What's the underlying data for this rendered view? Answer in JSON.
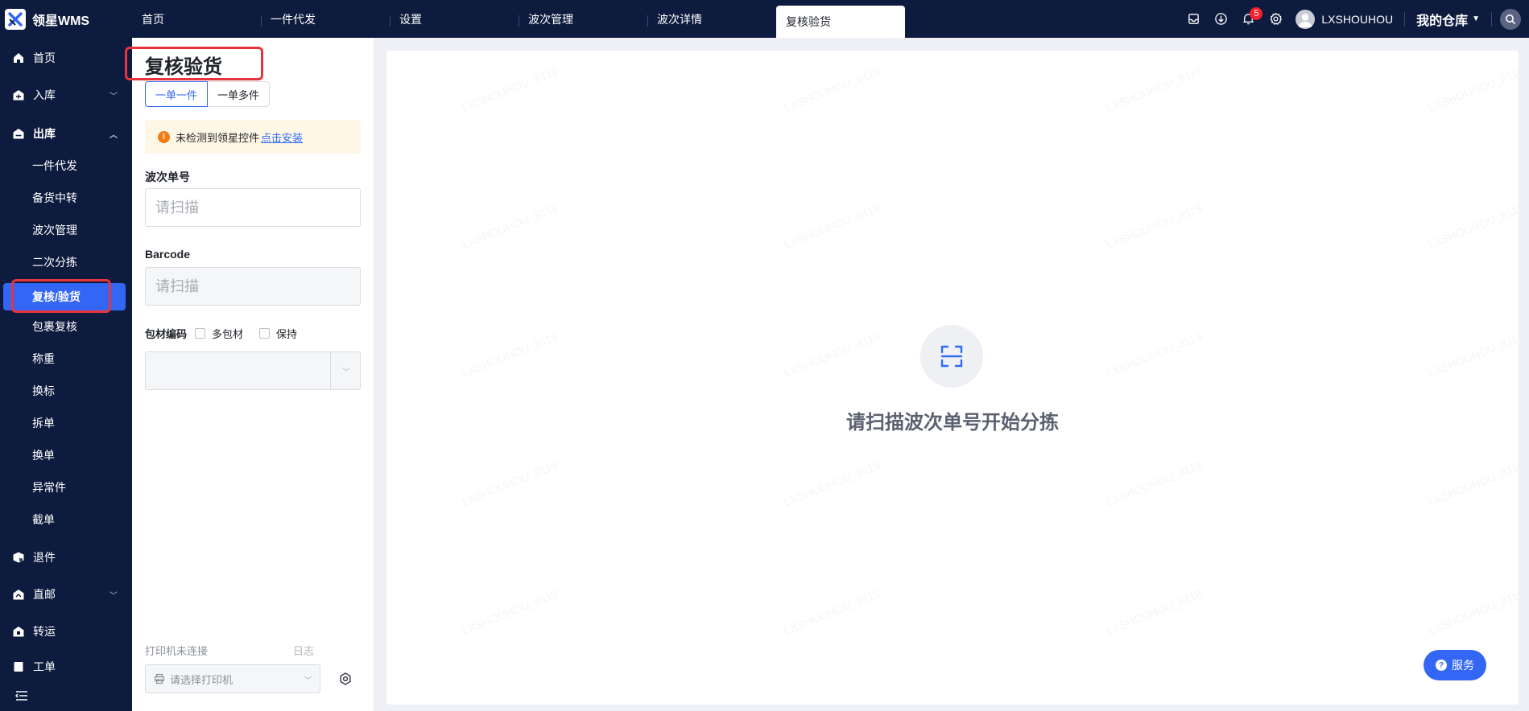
{
  "app": {
    "title": "领星WMS"
  },
  "tabs": [
    {
      "label": "首页"
    },
    {
      "label": "一件代发"
    },
    {
      "label": "设置"
    },
    {
      "label": "波次管理"
    },
    {
      "label": "波次详情"
    },
    {
      "label": "复核验货",
      "active": true
    }
  ],
  "topbar": {
    "notification_count": "5",
    "user_name": "LXSHOUHOU",
    "warehouse": "我的仓库",
    "icons": [
      "inbox-icon",
      "download-icon",
      "bell-icon",
      "settings-icon",
      "search-icon"
    ]
  },
  "sidebar": {
    "groups": [
      {
        "label": "首页",
        "icon": "home-icon"
      },
      {
        "label": "入库",
        "icon": "inbound-icon",
        "expandable": true
      },
      {
        "label": "出库",
        "icon": "outbound-icon",
        "expanded": true
      },
      {
        "label": "退件",
        "icon": "return-icon"
      },
      {
        "label": "直邮",
        "icon": "direct-mail-icon",
        "expandable": true
      },
      {
        "label": "转运",
        "icon": "transfer-icon"
      },
      {
        "label": "工单",
        "icon": "workorder-icon"
      }
    ],
    "items": [
      {
        "label": "一件代发"
      },
      {
        "label": "备货中转"
      },
      {
        "label": "波次管理"
      },
      {
        "label": "二次分拣"
      },
      {
        "label": "复核/验货",
        "active": true
      },
      {
        "label": "包裹复核"
      },
      {
        "label": "称重"
      },
      {
        "label": "换标"
      },
      {
        "label": "拆单"
      },
      {
        "label": "换单"
      },
      {
        "label": "异常件"
      },
      {
        "label": "截单"
      }
    ]
  },
  "panel": {
    "title": "复核验货",
    "modes": [
      "一单一件",
      "一单多件"
    ],
    "alert": {
      "text": "未检测到领星控件",
      "link": "点击安装"
    },
    "wave_label": "波次单号",
    "wave_placeholder": "请扫描",
    "barcode_label": "Barcode",
    "barcode_placeholder": "请扫描",
    "package_label": "包材编码",
    "multi_package": "多包材",
    "keep": "保持",
    "printer_status": "打印机未连接",
    "log": "日志",
    "printer_placeholder": "请选择打印机"
  },
  "main": {
    "empty_text": "请扫描波次单号开始分拣",
    "watermark": "LXSHOUHOU_8119"
  },
  "service": {
    "label": "服务"
  },
  "colors": {
    "nav_bg": "#0d1b3e",
    "accent": "#3366f5",
    "highlight": "#e8343c",
    "alert_bg": "#fff7e6"
  }
}
